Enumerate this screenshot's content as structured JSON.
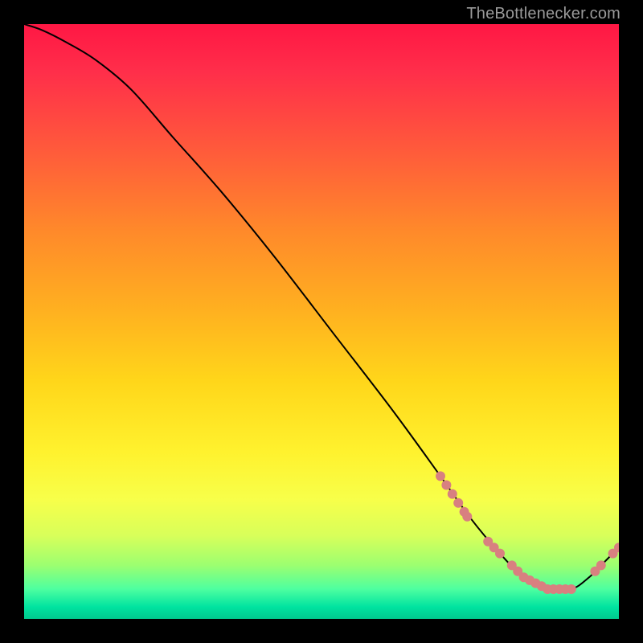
{
  "watermark": "TheBottlenecker.com",
  "chart_data": {
    "type": "line",
    "title": "",
    "xlabel": "",
    "ylabel": "",
    "xlim": [
      0,
      100
    ],
    "ylim": [
      0,
      100
    ],
    "grid": false,
    "legend": false,
    "series": [
      {
        "name": "bottleneck-curve",
        "color": "#000000",
        "x": [
          0,
          3,
          7,
          12,
          18,
          25,
          33,
          42,
          52,
          62,
          70,
          75,
          80,
          84,
          88,
          92,
          95,
          98,
          100
        ],
        "y": [
          100,
          99,
          97,
          94,
          89,
          81,
          72,
          61,
          48,
          35,
          24,
          17,
          11,
          7,
          5,
          5,
          7,
          10,
          12
        ]
      }
    ],
    "markers": [
      {
        "x": 70.0,
        "y": 24.0
      },
      {
        "x": 71.0,
        "y": 22.5
      },
      {
        "x": 72.0,
        "y": 21.0
      },
      {
        "x": 73.0,
        "y": 19.5
      },
      {
        "x": 74.0,
        "y": 18.0
      },
      {
        "x": 74.5,
        "y": 17.2
      },
      {
        "x": 78.0,
        "y": 13.0
      },
      {
        "x": 79.0,
        "y": 12.0
      },
      {
        "x": 80.0,
        "y": 11.0
      },
      {
        "x": 82.0,
        "y": 9.0
      },
      {
        "x": 83.0,
        "y": 8.0
      },
      {
        "x": 84.0,
        "y": 7.0
      },
      {
        "x": 85.0,
        "y": 6.5
      },
      {
        "x": 86.0,
        "y": 6.0
      },
      {
        "x": 87.0,
        "y": 5.5
      },
      {
        "x": 88.0,
        "y": 5.0
      },
      {
        "x": 89.0,
        "y": 5.0
      },
      {
        "x": 90.0,
        "y": 5.0
      },
      {
        "x": 91.0,
        "y": 5.0
      },
      {
        "x": 92.0,
        "y": 5.0
      },
      {
        "x": 96.0,
        "y": 8.0
      },
      {
        "x": 97.0,
        "y": 9.0
      },
      {
        "x": 99.0,
        "y": 11.0
      },
      {
        "x": 100.0,
        "y": 12.0
      }
    ],
    "marker_radius": 6,
    "marker_color": "#d88080",
    "background": "rainbow-gradient"
  }
}
